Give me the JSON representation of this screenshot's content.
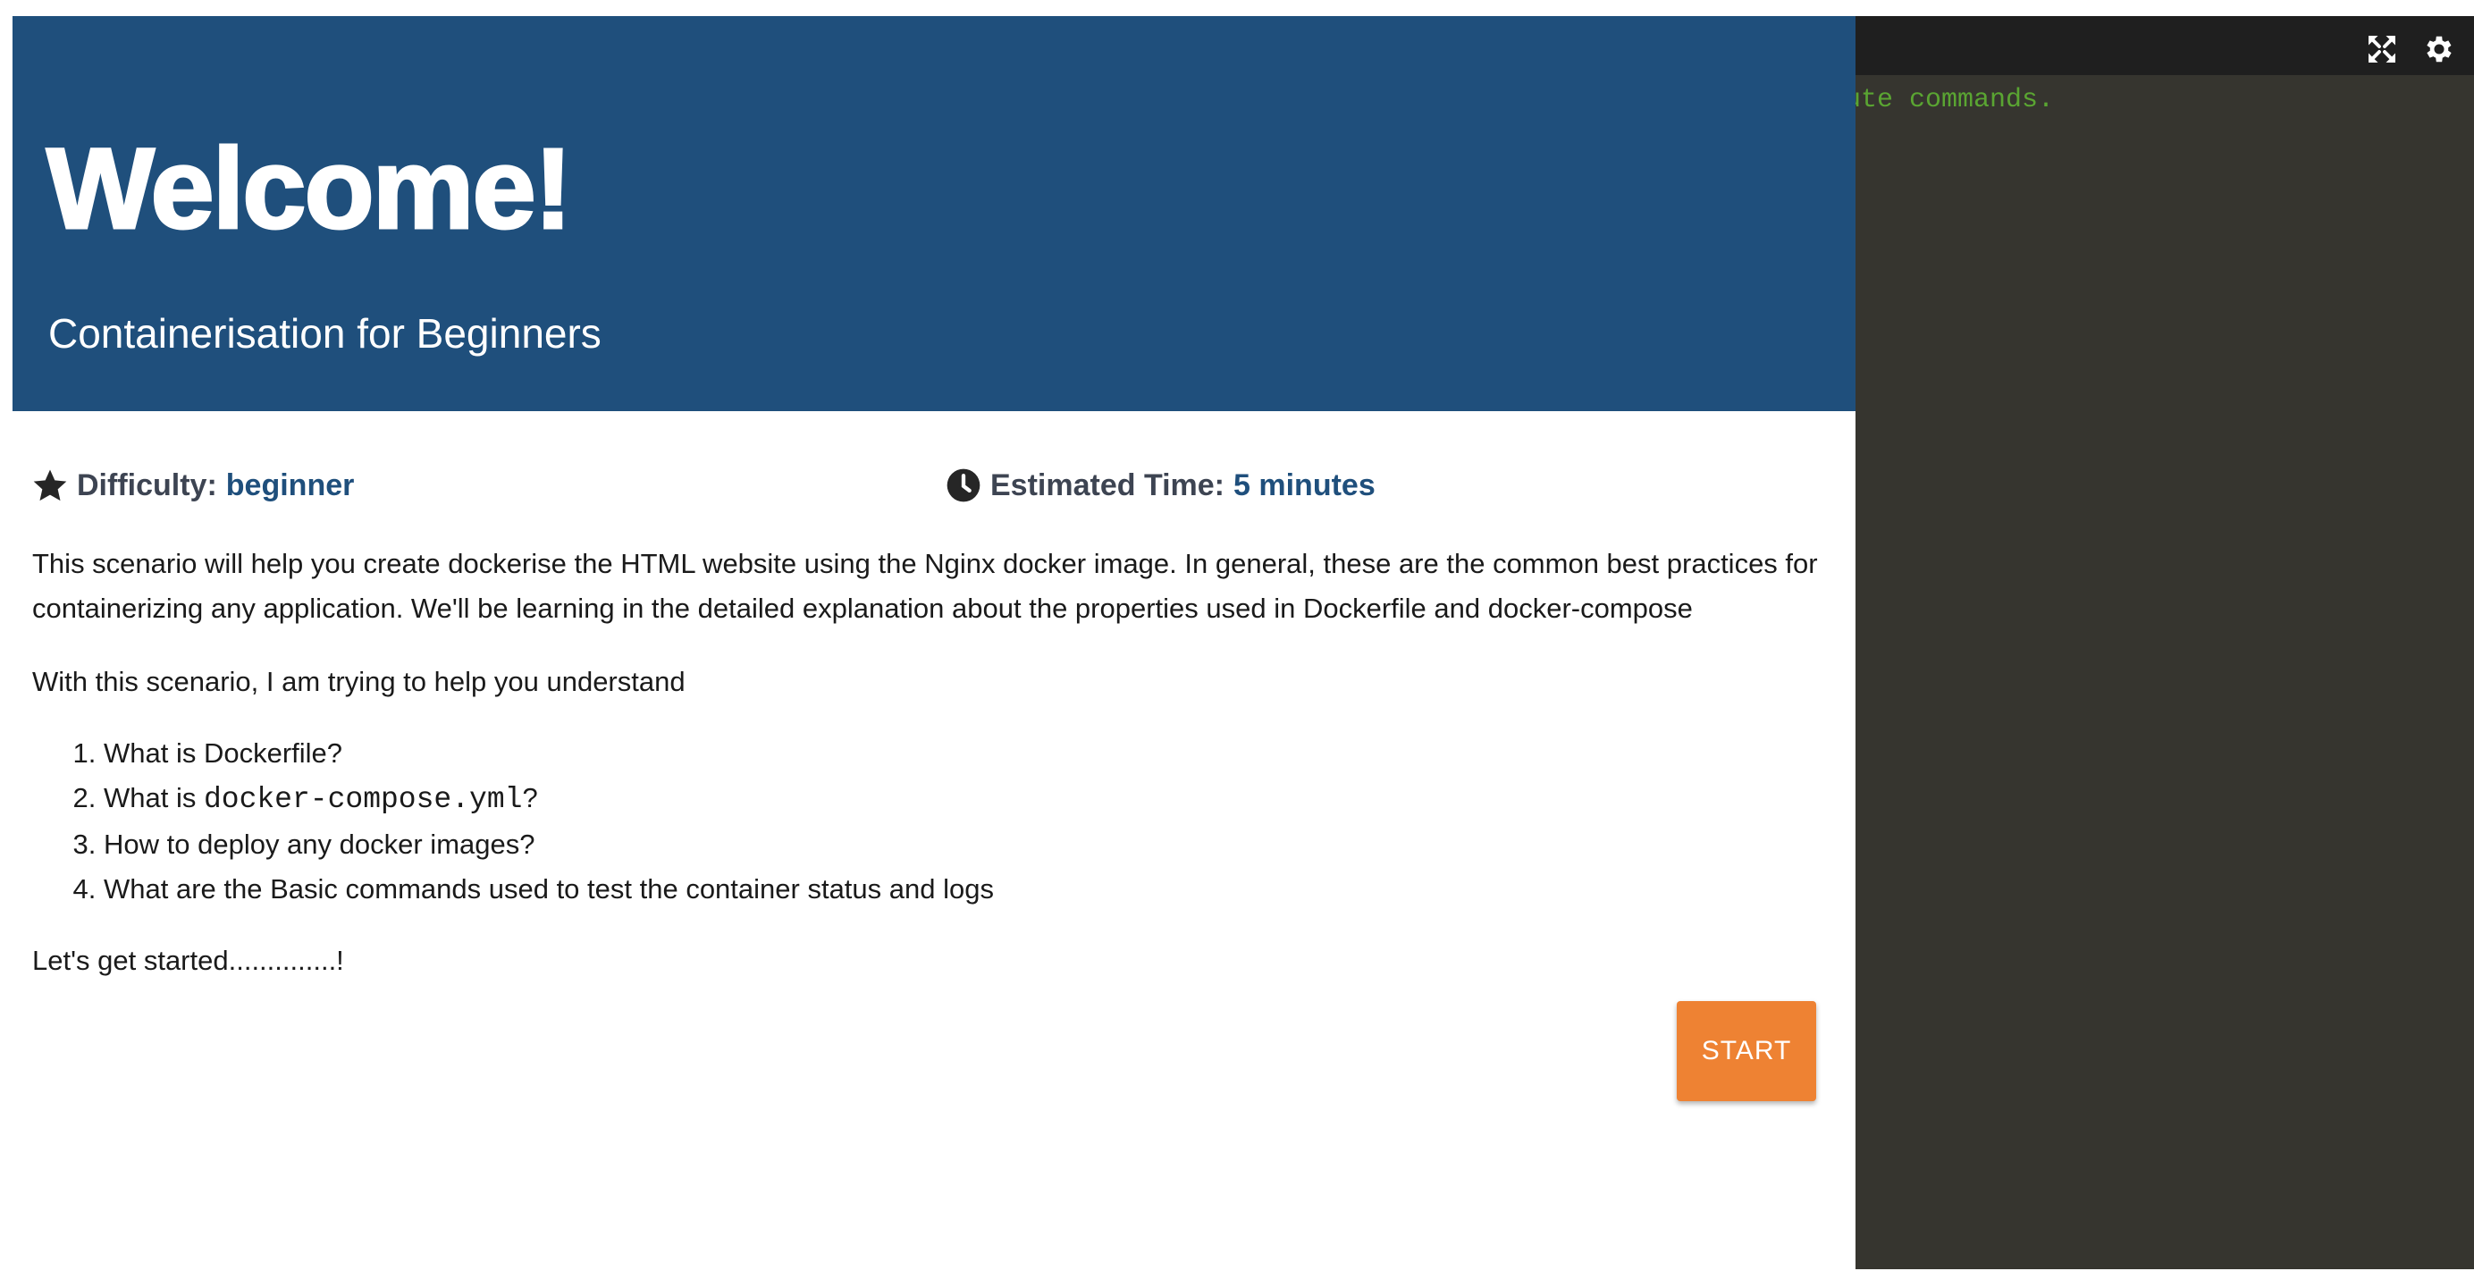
{
  "hero": {
    "title": "Welcome!",
    "subtitle": "Containerisation for Beginners"
  },
  "meta": {
    "difficulty_label": "Difficulty:",
    "difficulty_value": "beginner",
    "time_label": "Estimated Time:",
    "time_value": "5 minutes"
  },
  "content": {
    "intro": "This scenario will help you create dockerise the HTML website using the Nginx docker image. In general, these are the common best practices for containerizing any application. We'll be learning in the detailed explanation about the properties used in Dockerfile and docker-compose",
    "help": "With this scenario, I am trying to help you understand",
    "steps": [
      {
        "text": "What is Dockerfile?"
      },
      {
        "prefix": "What is ",
        "code": "docker-compose.yml",
        "suffix": "?"
      },
      {
        "text": "How to deploy any docker images?"
      },
      {
        "text": "What are the Basic commands used to test the container status and logs"
      }
    ],
    "closing": "Let's get started..............!"
  },
  "start_button": {
    "label": "START"
  },
  "terminal": {
    "output_line": "cute commands.",
    "icons": [
      "expand-icon",
      "gear-icon"
    ]
  },
  "colors": {
    "hero_bg": "#1f4f7c",
    "accent": "#1f4f7c",
    "button": "#ee8233",
    "terminal_bg": "#36352f",
    "terminal_toolbar": "#1f1f1f",
    "terminal_text": "#5aa532"
  },
  "icons": {
    "difficulty": "star-icon",
    "time": "clock-icon"
  }
}
